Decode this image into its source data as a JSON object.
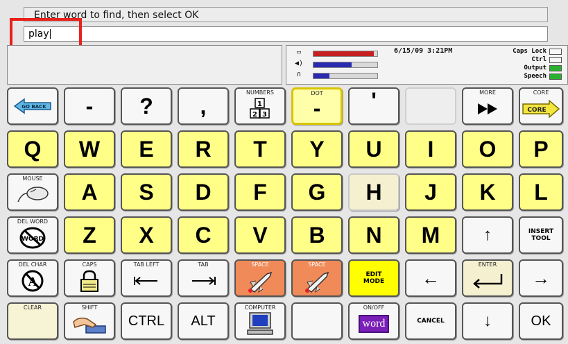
{
  "prompt_text": "Enter word to find, then select OK",
  "find_input_value": "play",
  "status": {
    "datetime": "6/15/09 3:21PM",
    "indicators": [
      {
        "label": "Caps Lock",
        "on": false
      },
      {
        "label": "Ctrl",
        "on": false
      },
      {
        "label": "Output",
        "on": true
      },
      {
        "label": "Speech",
        "on": true
      }
    ],
    "meters": [
      {
        "icon": "battery-icon",
        "level": 0.95,
        "color": "#c62020"
      },
      {
        "icon": "speaker-icon",
        "level": 0.6,
        "color": "#2a2ab0"
      },
      {
        "icon": "headphones-icon",
        "level": 0.25,
        "color": "#2a2ab0"
      }
    ]
  },
  "colors": {
    "letter_key": "#ffff88",
    "highlight": "#e8211a",
    "indicator_on": "#27b12e"
  },
  "keys": {
    "go_back": "GO BACK",
    "dash": "-",
    "question": "?",
    "comma": ",",
    "numbers": "NUMBERS",
    "dot_label": "DOT",
    "dot_symbol": "-",
    "apostrophe": "'",
    "more": "MORE",
    "core_label": "CORE",
    "core_button": "CORE",
    "row_qwerty": [
      "Q",
      "W",
      "E",
      "R",
      "T",
      "Y",
      "U",
      "I",
      "O",
      "P"
    ],
    "mouse": "MOUSE",
    "row_asdf": [
      "A",
      "S",
      "D",
      "F",
      "G",
      "H",
      "J",
      "K",
      "L"
    ],
    "del_word": "DEL WORD",
    "del_word_icon_text": "WORD",
    "row_zxcv": [
      "Z",
      "X",
      "C",
      "V",
      "B",
      "N",
      "M"
    ],
    "up_arrow": "↑",
    "insert_tool": "INSERT TOOL",
    "del_char": "DEL CHAR",
    "caps": "CAPS",
    "tab_left": "TAB LEFT",
    "tab": "TAB",
    "space": "SPACE",
    "edit_mode": "EDIT MODE",
    "left_arrow": "←",
    "enter": "ENTER",
    "right_arrow": "→",
    "clear": "CLEAR",
    "shift": "SHIFT",
    "ctrl": "CTRL",
    "alt": "ALT",
    "computer": "COMPUTER",
    "on_off": "ON/OFF",
    "word": "word",
    "cancel": "CANCEL",
    "down_arrow": "↓",
    "ok": "OK"
  }
}
